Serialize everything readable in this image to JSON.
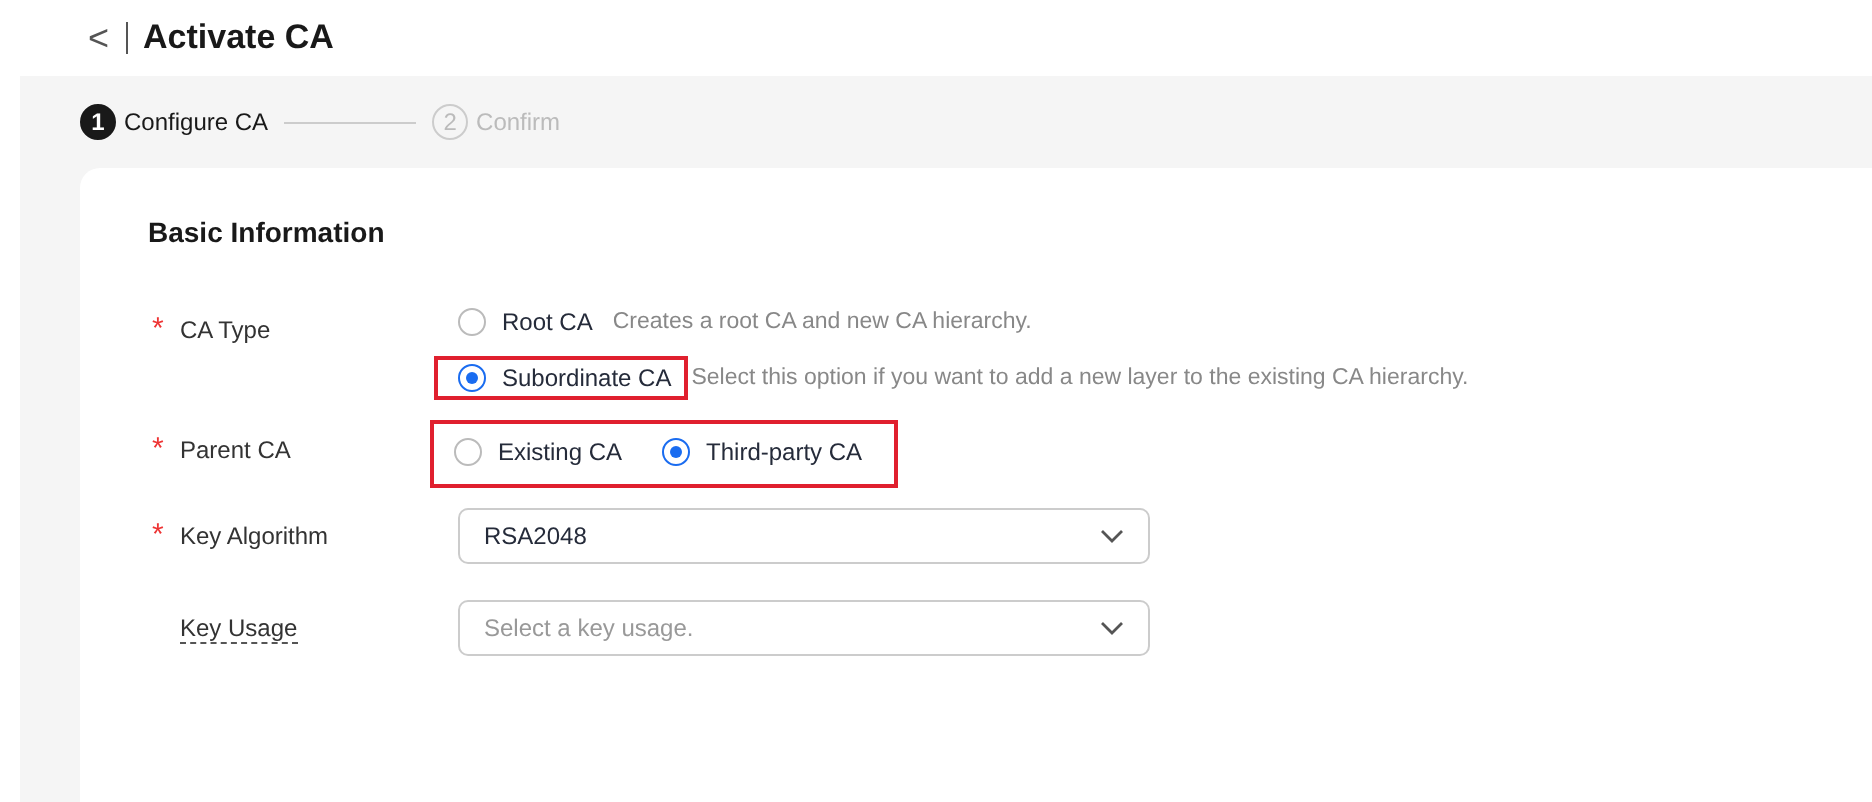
{
  "header": {
    "back": "<",
    "title": "Activate CA"
  },
  "steps": [
    {
      "number": "1",
      "label": "Configure CA",
      "selected": true
    },
    {
      "number": "2",
      "label": "Confirm",
      "selected": false
    }
  ],
  "section": {
    "title": "Basic Information"
  },
  "form": [
    {
      "kind": "radio-stack",
      "label": "CA Type",
      "required_mark": "*",
      "dashed": false,
      "highlighted": false,
      "options": [
        {
          "label": "Root CA",
          "hint": "Creates a root CA and new CA hierarchy.",
          "selected": false,
          "highlighted": false
        },
        {
          "label": "Subordinate CA",
          "hint": "Select this option if you want to add a new layer to the existing CA hierarchy.",
          "selected": true,
          "highlighted": true
        }
      ]
    },
    {
      "kind": "radio-inline",
      "label": "Parent CA",
      "required_mark": "*",
      "dashed": false,
      "highlighted": true,
      "options": [
        {
          "label": "Existing CA",
          "selected": false
        },
        {
          "label": "Third-party CA",
          "selected": true
        }
      ]
    },
    {
      "kind": "select",
      "label": "Key Algorithm",
      "required_mark": "*",
      "dashed": false,
      "value": "RSA2048"
    },
    {
      "kind": "select",
      "label": "Key Usage",
      "dashed": true,
      "placeholder": "Select a key usage."
    }
  ]
}
